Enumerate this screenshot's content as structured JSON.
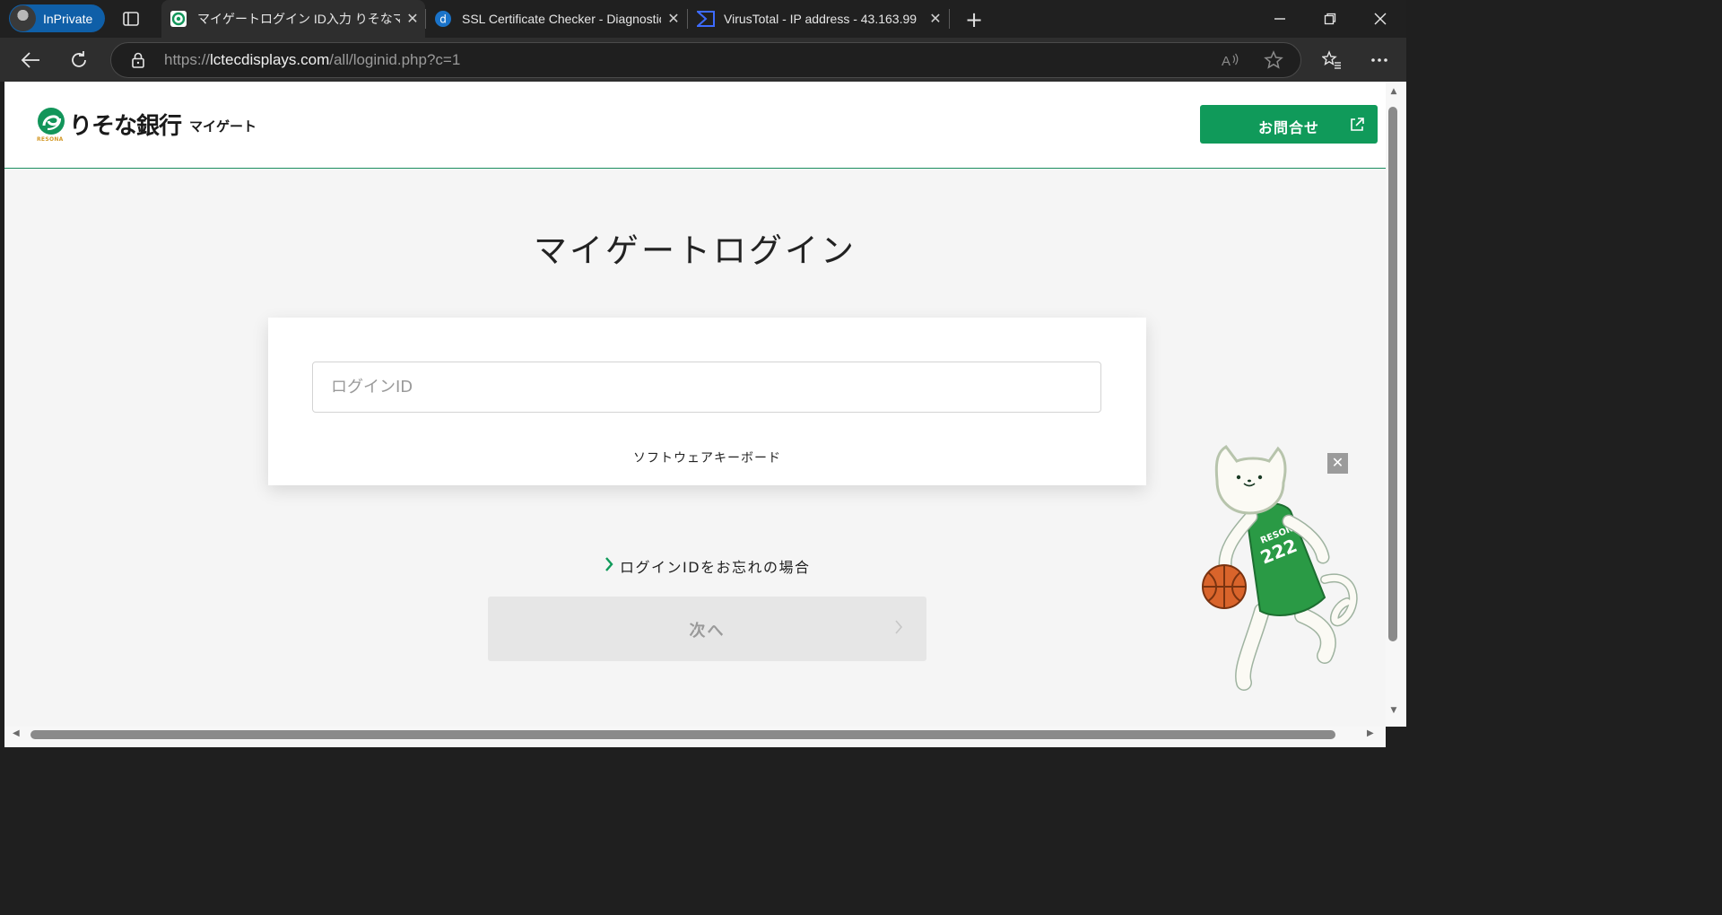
{
  "browser": {
    "inprivate_label": "InPrivate",
    "tabs": [
      {
        "title": "マイゲートログイン ID入力 りそなマイゲート",
        "active": true,
        "favicon": "resona-favicon"
      },
      {
        "title": "SSL Certificate Checker - Diagnostic Tool",
        "active": false,
        "favicon": "digicert-favicon"
      },
      {
        "title": "VirusTotal - IP address - 43.163.99",
        "active": false,
        "favicon": "virustotal-favicon"
      }
    ],
    "url_prefix": "https://",
    "url_host": "lctecdisplays.com",
    "url_path": "/all/loginid.php?c=1"
  },
  "header": {
    "bank_name": "りそな銀行",
    "sub_brand": "マイゲート",
    "logo_small_text": "RESONA",
    "contact_label": "お問合せ"
  },
  "main": {
    "title": "マイゲートログイン",
    "login_placeholder": "ログインID",
    "login_value": "",
    "software_keyboard": "ソフトウェアキーボード",
    "forgot_link": "ログインIDをお忘れの場合",
    "next_label": "次へ"
  },
  "mascot": {
    "jersey_text": "RESONA",
    "jersey_number": "222"
  },
  "colors": {
    "brand_green": "#109a5a",
    "header_line": "#1a8d5f",
    "tab_active_bg": "#2e2e2e",
    "inprivate_blue": "#0f5fa8"
  }
}
